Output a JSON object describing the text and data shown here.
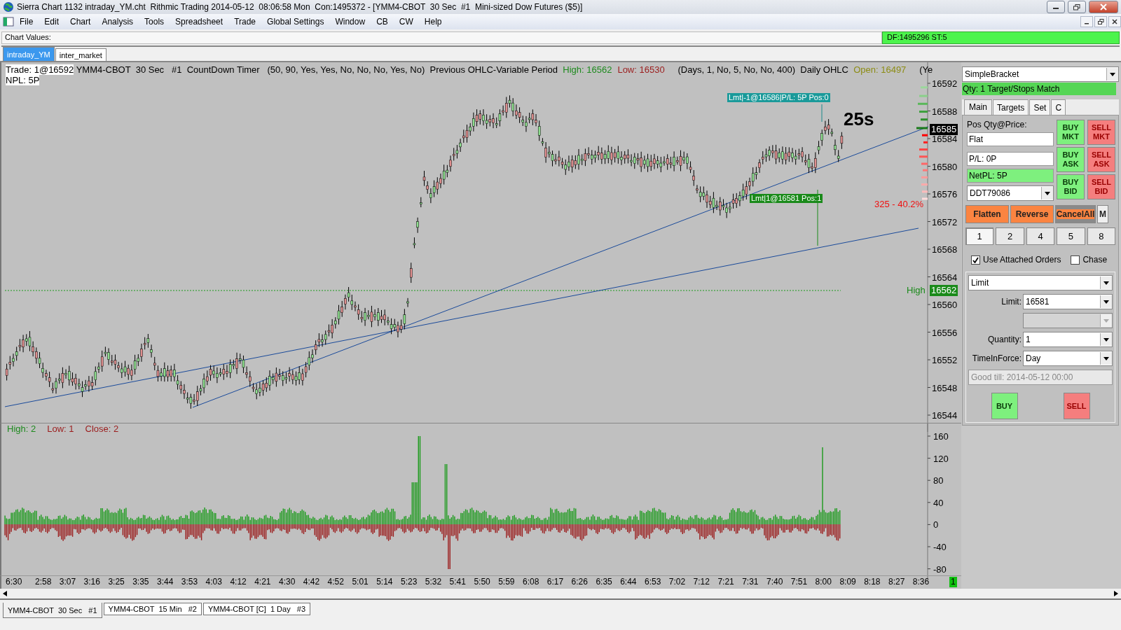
{
  "window": {
    "title": "Sierra Chart 1132 intraday_YM.cht  Rithmic Trading 2014-05-12  08:06:58 Mon  Con:1495372 - [YMM4-CBOT  30 Sec  #1  Mini-sized Dow Futures ($5)]"
  },
  "menu": [
    "File",
    "Edit",
    "Chart",
    "Analysis",
    "Tools",
    "Spreadsheet",
    "Trade",
    "Global Settings",
    "Window",
    "CB",
    "CW",
    "Help"
  ],
  "chart_values": {
    "label": "Chart Values:",
    "status": "DF:1495296  ST:5"
  },
  "chart_tabs": [
    {
      "label": "intraday_YM",
      "selected": true
    },
    {
      "label": "inter_market",
      "selected": false
    }
  ],
  "study_header": [
    {
      "text": "Trade: 1@16592",
      "kind": "highlight"
    },
    {
      "text": " YMM4-CBOT  30 Sec   #1  CountDown Timer   (50, 90, Yes, Yes, No, No, No, Yes, No)  Previous OHLC-Variable Period  ",
      "kind": "plain"
    },
    {
      "text": "High: 16562",
      "kind": "colored",
      "color": "#1e8a1e"
    },
    {
      "text": "Low: 16530",
      "kind": "colored",
      "color": "#9b1c1c"
    },
    {
      "text": "   (Days, 1, No, 5, No, No, 400)  Daily OHLC  ",
      "kind": "plain"
    },
    {
      "text": "Open: 16497",
      "kind": "colored",
      "color": "#8c8c14"
    },
    {
      "text": "   (Ye",
      "kind": "plain"
    }
  ],
  "npl": "NPL: 5P",
  "price_axis": {
    "labels": [
      "16592",
      "16588",
      "16584",
      "16580",
      "16576",
      "16572",
      "16568",
      "16564",
      "16560",
      "16556",
      "16552",
      "16548",
      "16544"
    ],
    "current": "16585",
    "high_label": "High",
    "high_value": "16562"
  },
  "order_labels": [
    {
      "text": "Lmt|-1@16586|P/L: 5P Pos:0",
      "kind": "exit"
    },
    {
      "text": "Lmt|1@16581 Pos:1",
      "kind": "entry"
    }
  ],
  "timer": "25s",
  "volume_percent": "325 - 40.2%",
  "lower_header": [
    {
      "text": "High: 2",
      "color": "#1e8a1e"
    },
    {
      "text": "Low: 1",
      "color": "#9b1c1c"
    },
    {
      "text": "Close: 2",
      "color": "#9b1c1c"
    }
  ],
  "volume_axis": [
    "160",
    "120",
    "80",
    "40",
    "0",
    "-40",
    "-80"
  ],
  "time_axis": {
    "labels": [
      "6:30",
      "2:58",
      "3:07",
      "3:16",
      "3:25",
      "3:35",
      "3:44",
      "3:53",
      "4:03",
      "4:12",
      "4:21",
      "4:30",
      "4:42",
      "4:52",
      "5:01",
      "5:14",
      "5:23",
      "5:32",
      "5:41",
      "5:50",
      "5:59",
      "6:08",
      "6:17",
      "6:26",
      "6:35",
      "6:44",
      "6:53",
      "7:02",
      "7:12",
      "7:21",
      "7:31",
      "7:40",
      "7:51",
      "8:00",
      "8:09",
      "8:18",
      "8:27",
      "8:36"
    ],
    "badge": "1"
  },
  "bottom_tabs": [
    {
      "label": "YMM4-CBOT  30 Sec   #1",
      "selected": true
    },
    {
      "label": "YMM4-CBOT  15 Min   #2",
      "selected": false
    },
    {
      "label": "YMM4-CBOT [C]  1 Day   #3",
      "selected": false
    }
  ],
  "trade_panel": {
    "strategy": "SimpleBracket",
    "status": "Qty: 1 Target/Stops Match",
    "tabs": [
      {
        "label": "Main",
        "selected": true
      },
      {
        "label": "Targets",
        "selected": false
      },
      {
        "label": "Set",
        "selected": false
      },
      {
        "label": "C",
        "selected": false
      }
    ],
    "pos_label": "Pos Qty@Price:",
    "pos_value": "Flat",
    "pl": "P/L: 0P",
    "net_pl": "NetPL: 5P",
    "account": "DDT79086",
    "order_buttons": [
      {
        "label": "BUY MKT",
        "kind": "buy"
      },
      {
        "label": "SELL MKT",
        "kind": "sell"
      },
      {
        "label": "BUY ASK",
        "kind": "buy"
      },
      {
        "label": "SELL ASK",
        "kind": "sell"
      },
      {
        "label": "BUY BID",
        "kind": "buy"
      },
      {
        "label": "SELL BID",
        "kind": "sell"
      }
    ],
    "actions": [
      {
        "label": "Flatten",
        "kind": "orange"
      },
      {
        "label": "Reverse",
        "kind": "orange"
      },
      {
        "label": "CancelAll",
        "kind": "grey"
      },
      {
        "label": "M",
        "kind": "plain"
      }
    ],
    "quantities": [
      {
        "label": "1",
        "selected": true
      },
      {
        "label": "2",
        "selected": false
      },
      {
        "label": "4",
        "selected": false
      },
      {
        "label": "5",
        "selected": false
      },
      {
        "label": "8",
        "selected": false
      }
    ],
    "options": [
      {
        "label": "Use Attached Orders",
        "checked": true
      },
      {
        "label": "Chase",
        "checked": false
      }
    ],
    "order_type": "Limit",
    "fields": [
      {
        "label": "Limit:",
        "value": "16581",
        "disabled": false
      },
      {
        "disabled": true
      },
      {
        "label": "Quantity:",
        "value": "1",
        "disabled": false
      },
      {
        "label": "TimeInForce:",
        "value": "Day",
        "disabled": false
      }
    ],
    "good_till": "Good till: 2014-05-12 00:00",
    "submit": [
      {
        "label": "BUY",
        "kind": "buy"
      },
      {
        "label": "SELL",
        "kind": "sell"
      }
    ]
  }
}
